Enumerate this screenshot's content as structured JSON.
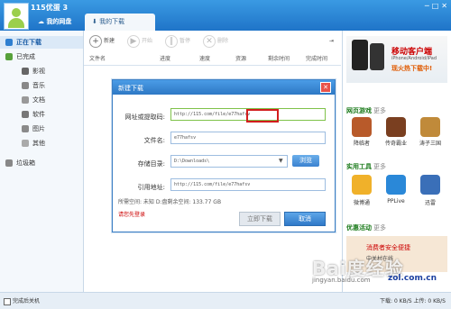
{
  "app": {
    "title": "115优蛋 3",
    "win_buttons": [
      "─",
      "□",
      "✕"
    ]
  },
  "tabs": [
    {
      "label": "我的网盘"
    },
    {
      "label": "我的下载"
    }
  ],
  "sidebar": {
    "items": [
      {
        "label": "正在下载",
        "icon": "download-icon"
      },
      {
        "label": "已完成",
        "icon": "check-icon"
      },
      {
        "label": "影视",
        "icon": "film-icon"
      },
      {
        "label": "音乐",
        "icon": "music-icon"
      },
      {
        "label": "文档",
        "icon": "document-icon"
      },
      {
        "label": "软件",
        "icon": "software-icon"
      },
      {
        "label": "图片",
        "icon": "picture-icon"
      },
      {
        "label": "其他",
        "icon": "other-icon"
      },
      {
        "label": "垃圾箱",
        "icon": "trash-icon"
      }
    ]
  },
  "toolbar": {
    "new_label": "新建",
    "start_label": "开始",
    "pause_label": "暂停",
    "delete_label": "删除"
  },
  "columns": [
    "文件名",
    "进度",
    "速度",
    "资源",
    "剩余时间",
    "完成时间"
  ],
  "right": {
    "promo_title": "移动客户端",
    "promo_sub": "iPhone/Android/iPad",
    "promo_hot": "现火热下载中!",
    "games_title": "网页游戏",
    "more": "更多",
    "games": [
      "降临者",
      "传奇霸业",
      "涛子三国"
    ],
    "tools_title": "实用工具",
    "tools": [
      "微博通",
      "PPLive",
      "迅雷"
    ],
    "promos_title": "优惠活动",
    "ad_line1": "消费者安全便捷",
    "ad_line2": "中关村在线"
  },
  "dialog": {
    "title": "新建下载",
    "url_label": "网址或提取码:",
    "url_value": "http://115.com/file/e77hafsv",
    "name_label": "文件名:",
    "name_value": "e77hafsv",
    "dir_label": "存储目录:",
    "dir_value": "D:\\Downloads\\",
    "browse_label": "浏览",
    "ref_label": "引用地址:",
    "ref_value": "http://115.com/file/e77hafsv",
    "space_info": "所需空间: 未知  D:盘剩余空间: 133.77 GB",
    "login_hint": "请您先登录",
    "download_label": "立即下载",
    "cancel_label": "取消"
  },
  "status": {
    "shutdown_label": "完成后关机",
    "speed": "下载: 0 KB/S    上传: 0 KB/S"
  },
  "watermark": {
    "text": "Bai度经验",
    "sub": "jingyan.baidu.com",
    "zol": "zol.com.cn"
  }
}
